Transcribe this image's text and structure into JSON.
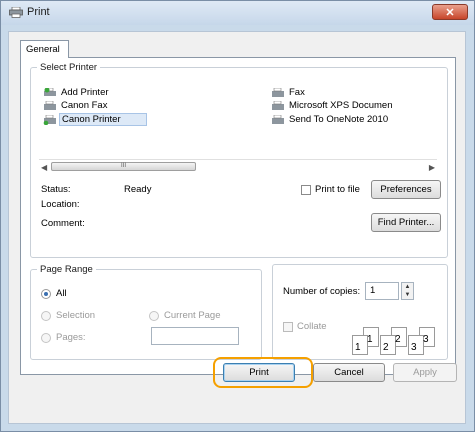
{
  "window": {
    "title": "Print",
    "close_label": "✕"
  },
  "tabs": [
    {
      "label": "General"
    }
  ],
  "select_printer": {
    "legend": "Select Printer",
    "printers_left": [
      "Add Printer",
      "Canon Fax",
      "Canon Printer"
    ],
    "printers_right": [
      "Fax",
      "Microsoft XPS Documen",
      "Send To OneNote 2010"
    ],
    "selected": "Canon Printer",
    "scroll_thumb_grip": "III"
  },
  "status": {
    "status_label": "Status:",
    "status_value": "Ready",
    "location_label": "Location:",
    "location_value": "",
    "comment_label": "Comment:",
    "comment_value": ""
  },
  "print_to_file_label": "Print to file",
  "preferences_label": "Preferences",
  "find_printer_label": "Find Printer...",
  "page_range": {
    "legend": "Page Range",
    "all_label": "All",
    "selection_label": "Selection",
    "current_page_label": "Current Page",
    "pages_label": "Pages:",
    "pages_value": ""
  },
  "copies": {
    "label": "Number of copies:",
    "value": "1",
    "collate_label": "Collate",
    "collate_icon_numbers": [
      "1",
      "1",
      "2",
      "2",
      "3",
      "3"
    ]
  },
  "buttons": {
    "print": "Print",
    "cancel": "Cancel",
    "apply": "Apply"
  },
  "colors": {
    "highlight": "#f5a000",
    "titlebar": "#c6d7ea",
    "close": "#c7452a"
  }
}
